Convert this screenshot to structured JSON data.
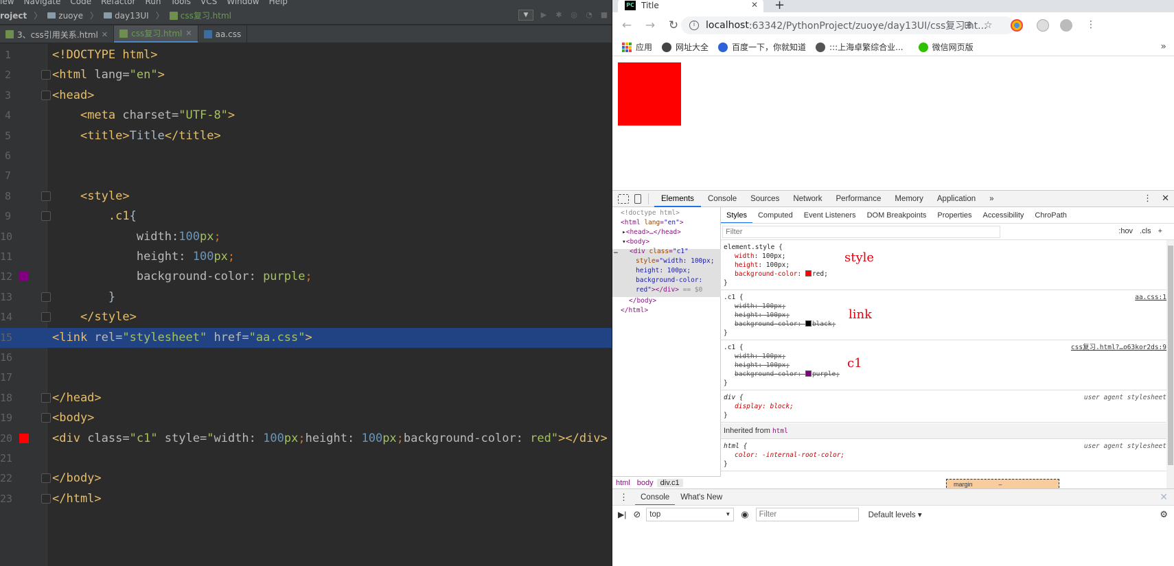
{
  "ide": {
    "menu": [
      "iew",
      "Navigate",
      "Code",
      "Refactor",
      "Run",
      "Tools",
      "VCS",
      "Window",
      "Help"
    ],
    "breadcrumbs": [
      "roject",
      "zuoye",
      "day13UI",
      "css复习.html"
    ],
    "tabs": [
      {
        "label": "3、css引用关系.html",
        "active": false
      },
      {
        "label": "css复习.html",
        "active": true
      },
      {
        "label": "aa.css",
        "active": false
      }
    ],
    "code_lines": [
      {
        "n": "1",
        "html": "<span class='t'>&lt;!DOCTYPE html&gt;</span>"
      },
      {
        "n": "2",
        "html": "<span class='t'>&lt;html </span><span class='a'>lang=</span><span class='s'>\"en\"</span><span class='t'>&gt;</span>"
      },
      {
        "n": "3",
        "html": "<span class='t'>&lt;head&gt;</span>"
      },
      {
        "n": "4",
        "html": "    <span class='t'>&lt;meta </span><span class='a'>charset=</span><span class='s'>\"UTF-8\"</span><span class='t'>&gt;</span>"
      },
      {
        "n": "5",
        "html": "    <span class='t'>&lt;title&gt;</span><span class='x'>Title</span><span class='t'>&lt;/title&gt;</span>"
      },
      {
        "n": "6",
        "html": ""
      },
      {
        "n": "7",
        "html": ""
      },
      {
        "n": "8",
        "html": "    <span class='t'>&lt;style&gt;</span>"
      },
      {
        "n": "9",
        "html": "        <span class='t'>.c1</span><span class='x'>{</span>"
      },
      {
        "n": "10",
        "html": "            <span class='a'>width:</span><span class='n'>100</span><span class='v'>px</span><span class='k'>;</span>"
      },
      {
        "n": "11",
        "html": "            <span class='a'>height: </span><span class='n'>100</span><span class='v'>px</span><span class='k'>;</span>"
      },
      {
        "n": "12",
        "html": "            <span class='a'>background-color: </span><span class='v'>purple</span><span class='k'>;</span>"
      },
      {
        "n": "13",
        "html": "        <span class='x'>}</span>"
      },
      {
        "n": "14",
        "html": "    <span class='t'>&lt;/style&gt;</span>"
      },
      {
        "n": "15",
        "html": "<span class='t'>&lt;link </span><span class='a'>rel=</span><span class='s'>\"stylesheet\"</span><span class='a'> href=</span><span class='s'>\"aa.css\"</span><span class='t'>&gt;</span>"
      },
      {
        "n": "16",
        "html": ""
      },
      {
        "n": "17",
        "html": ""
      },
      {
        "n": "18",
        "html": "<span class='t'>&lt;/head&gt;</span>"
      },
      {
        "n": "19",
        "html": "<span class='t'>&lt;body&gt;</span>"
      },
      {
        "n": "20",
        "html": "<span class='t'>&lt;div </span><span class='a'>class=</span><span class='s'>\"c1\"</span><span class='a'> style=</span><span class='s'>\"</span><span class='a'>width: </span><span class='n'>100</span><span class='v'>px</span><span class='k'>;</span><span class='a'>height: </span><span class='n'>100</span><span class='v'>px</span><span class='k'>;</span><span class='a'>background-color: </span><span class='v'>red</span><span class='s'>\"</span><span class='t'>&gt;&lt;/div&gt;</span>"
      },
      {
        "n": "21",
        "html": ""
      },
      {
        "n": "22",
        "html": "<span class='t'>&lt;/body&gt;</span>"
      },
      {
        "n": "23",
        "html": "<span class='t'>&lt;/html&gt;</span>"
      }
    ],
    "highlighted_line": "15",
    "gutter_swatches": [
      {
        "line": "12",
        "color": "#800080"
      },
      {
        "line": "20",
        "color": "#ff0000"
      }
    ]
  },
  "browser": {
    "tab_title": "Title",
    "tab_favicon": "PC",
    "url_host": "localhost",
    "url_rest": ":63342/PythonProject/zuoye/day13UI/css复习.ht...",
    "bookmarks": [
      "应用",
      "网址大全",
      "百度一下，你就知道",
      ":::上海卓繁综合业...",
      "微信网页版"
    ],
    "page_box_color": "#ff0000"
  },
  "devtools": {
    "tabs": [
      "Elements",
      "Console",
      "Sources",
      "Network",
      "Performance",
      "Memory",
      "Application"
    ],
    "active_tab": "Elements",
    "more": "»",
    "style_tabs": [
      "Styles",
      "Computed",
      "Event Listeners",
      "DOM Breakpoints",
      "Properties",
      "Accessibility",
      "ChroPath"
    ],
    "filter_placeholder": "Filter",
    "hov": ":hov",
    "cls": ".cls",
    "element_crumbs": [
      "html",
      "body",
      "div.c1"
    ],
    "element_style_selector": "element.style {",
    "rule_c1_aa_source": "aa.css:1",
    "rule_c1_inline_source": "css复习.html?…o63kor2ds:9",
    "ua_label": "user agent stylesheet",
    "div_selector": "div {",
    "display_prop": "display: block;",
    "inherited_label": "Inherited from",
    "inherited_from": "html",
    "html_selector": "html {",
    "color_prop": "color: -internal-root-color;",
    "boxmodel_label": "margin",
    "boxmodel_value": "–",
    "annotations": {
      "style": "style",
      "link": "link",
      "c1": "c1"
    },
    "drawer_tabs": [
      "Console",
      "What's New"
    ],
    "console_context": "top",
    "console_filter": "Filter",
    "console_levels": "Default levels ▾"
  }
}
